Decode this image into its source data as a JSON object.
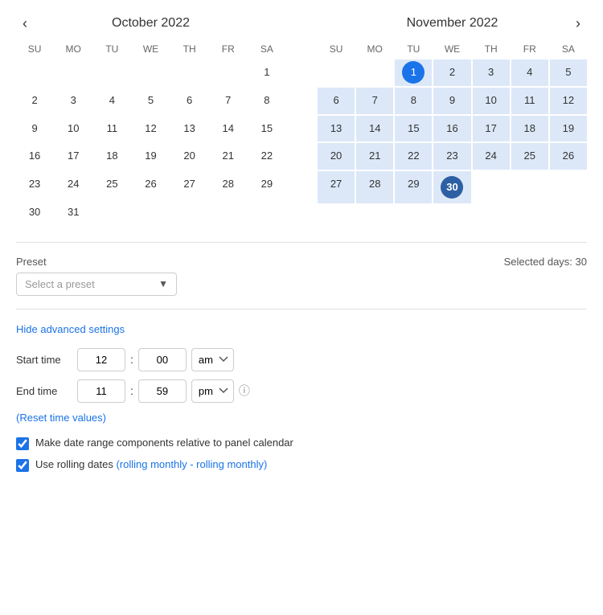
{
  "october": {
    "title": "October",
    "year": "2022",
    "days_of_week": [
      "SU",
      "MO",
      "TU",
      "WE",
      "TH",
      "FR",
      "SA"
    ],
    "weeks": [
      [
        null,
        null,
        null,
        null,
        null,
        null,
        "1"
      ],
      [
        "2",
        "3",
        "4",
        "5",
        "6",
        "7",
        "8"
      ],
      [
        "9",
        "10",
        "11",
        "12",
        "13",
        "14",
        "15"
      ],
      [
        "16",
        "17",
        "18",
        "19",
        "20",
        "21",
        "22"
      ],
      [
        "23",
        "24",
        "25",
        "26",
        "27",
        "28",
        "29"
      ],
      [
        "30",
        "31",
        null,
        null,
        null,
        null,
        null
      ]
    ]
  },
  "november": {
    "title": "November",
    "year": "2022",
    "days_of_week": [
      "SU",
      "MO",
      "TU",
      "WE",
      "TH",
      "FR",
      "SA"
    ],
    "weeks": [
      [
        null,
        null,
        "1",
        "2",
        "3",
        "4",
        "5"
      ],
      [
        "6",
        "7",
        "8",
        "9",
        "10",
        "11",
        "12"
      ],
      [
        "13",
        "14",
        "15",
        "16",
        "17",
        "18",
        "19"
      ],
      [
        "20",
        "21",
        "22",
        "23",
        "24",
        "25",
        "26"
      ],
      [
        "27",
        "28",
        "29",
        "30",
        null,
        null,
        null
      ]
    ]
  },
  "nav": {
    "prev_arrow": "‹",
    "next_arrow": "›"
  },
  "preset": {
    "label": "Preset",
    "placeholder": "Select a preset",
    "selected_days_label": "Selected days: 30"
  },
  "advanced": {
    "link_label": "Hide advanced settings"
  },
  "start_time": {
    "label": "Start time",
    "hour": "12",
    "minute": "00",
    "period": "am",
    "period_options": [
      "am",
      "pm"
    ]
  },
  "end_time": {
    "label": "End time",
    "hour": "11",
    "minute": "59",
    "period": "pm",
    "period_options": [
      "am",
      "pm"
    ]
  },
  "reset_time": {
    "label": "(Reset time values)"
  },
  "checkboxes": [
    {
      "id": "cb1",
      "checked": true,
      "label": "Make date range components relative to panel calendar"
    },
    {
      "id": "cb2",
      "checked": true,
      "label": "Use rolling dates ",
      "link_text": "(rolling monthly - rolling monthly)"
    }
  ]
}
